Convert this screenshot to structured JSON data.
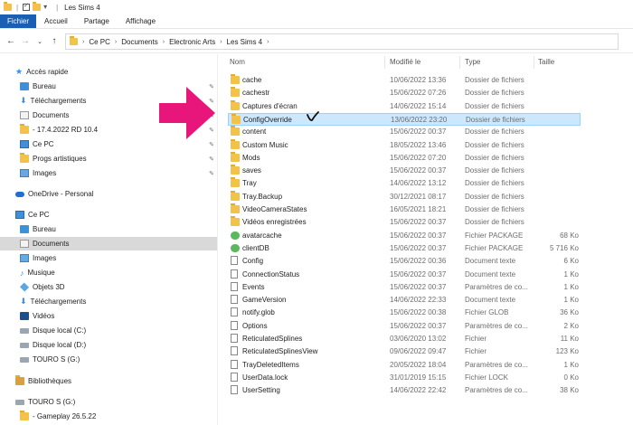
{
  "titlebar": {
    "title": "Les Sims 4",
    "quick_access_icons": [
      "properties-icon",
      "folder-icon",
      "customize-icon"
    ]
  },
  "ribbon": {
    "tabs": [
      "Fichier",
      "Accueil",
      "Partage",
      "Affichage"
    ]
  },
  "address": {
    "back_icon": "arrow-left-icon",
    "forward_icon": "arrow-right-icon",
    "recent_icon": "chevron-down-icon",
    "up_icon": "arrow-up-icon",
    "path": [
      "Ce PC",
      "Documents",
      "Electronic Arts",
      "Les Sims 4"
    ]
  },
  "sidebar": {
    "items": [
      {
        "label": "Accès rapide",
        "icon": "star-icon"
      },
      {
        "label": "Bureau",
        "icon": "desktop-icon",
        "pinned": true
      },
      {
        "label": "Téléchargements",
        "icon": "download-icon",
        "pinned": true
      },
      {
        "label": "Documents",
        "icon": "documents-icon",
        "pinned": true
      },
      {
        "label": "-    17.4.2022 RD 10.4",
        "icon": "folder-icon",
        "pinned": true
      },
      {
        "label": "Ce PC",
        "icon": "computer-icon",
        "pinned": true
      },
      {
        "label": "Progs  artistiques",
        "icon": "folder-icon",
        "pinned": true
      },
      {
        "label": "Images",
        "icon": "pictures-icon",
        "pinned": true
      },
      {
        "label": "OneDrive - Personal",
        "icon": "cloud-icon"
      },
      {
        "label": "Ce PC",
        "icon": "computer-icon"
      },
      {
        "label": "Bureau",
        "icon": "desktop-icon"
      },
      {
        "label": "Documents",
        "icon": "documents-icon",
        "selected": true
      },
      {
        "label": "Images",
        "icon": "pictures-icon"
      },
      {
        "label": "Musique",
        "icon": "music-icon"
      },
      {
        "label": "Objets 3D",
        "icon": "cube-icon"
      },
      {
        "label": "Téléchargements",
        "icon": "download-icon"
      },
      {
        "label": "Vidéos",
        "icon": "video-icon"
      },
      {
        "label": "Disque local (C:)",
        "icon": "drive-icon"
      },
      {
        "label": "Disque local (D:)",
        "icon": "drive-icon"
      },
      {
        "label": "TOURO S (G:)",
        "icon": "drive-icon"
      },
      {
        "label": "Bibliothèques",
        "icon": "library-icon"
      },
      {
        "label": "TOURO S (G:)",
        "icon": "drive-icon"
      },
      {
        "label": "-          Gameplay 26.5.22",
        "icon": "folder-icon"
      }
    ]
  },
  "columns": {
    "name": "Nom",
    "modified": "Modifié le",
    "type": "Type",
    "size": "Taille"
  },
  "files": [
    {
      "name": "cache",
      "date": "10/06/2022 13:36",
      "type": "Dossier de fichiers",
      "size": "",
      "kind": "folder"
    },
    {
      "name": "cachestr",
      "date": "15/06/2022 07:26",
      "type": "Dossier de fichiers",
      "size": "",
      "kind": "folder"
    },
    {
      "name": "Captures d'écran",
      "date": "14/06/2022 15:14",
      "type": "Dossier de fichiers",
      "size": "",
      "kind": "folder"
    },
    {
      "name": "ConfigOverride",
      "date": "13/06/2022 23:20",
      "type": "Dossier de fichiers",
      "size": "",
      "kind": "folder",
      "selected": true
    },
    {
      "name": "content",
      "date": "15/06/2022 00:37",
      "type": "Dossier de fichiers",
      "size": "",
      "kind": "folder"
    },
    {
      "name": "Custom Music",
      "date": "18/05/2022 13:46",
      "type": "Dossier de fichiers",
      "size": "",
      "kind": "folder"
    },
    {
      "name": "Mods",
      "date": "15/06/2022 07:20",
      "type": "Dossier de fichiers",
      "size": "",
      "kind": "folder"
    },
    {
      "name": "saves",
      "date": "15/06/2022 00:37",
      "type": "Dossier de fichiers",
      "size": "",
      "kind": "folder"
    },
    {
      "name": "Tray",
      "date": "14/06/2022 13:12",
      "type": "Dossier de fichiers",
      "size": "",
      "kind": "folder"
    },
    {
      "name": "Tray.Backup",
      "date": "30/12/2021 08:17",
      "type": "Dossier de fichiers",
      "size": "",
      "kind": "folder"
    },
    {
      "name": "VideoCameraStates",
      "date": "16/05/2021 18:21",
      "type": "Dossier de fichiers",
      "size": "",
      "kind": "folder"
    },
    {
      "name": "Vidéos enregistrées",
      "date": "15/06/2022 00:37",
      "type": "Dossier de fichiers",
      "size": "",
      "kind": "folder"
    },
    {
      "name": "avatarcache",
      "date": "15/06/2022 00:37",
      "type": "Fichier PACKAGE",
      "size": "68 Ko",
      "kind": "package"
    },
    {
      "name": "clientDB",
      "date": "15/06/2022 00:37",
      "type": "Fichier PACKAGE",
      "size": "5 716 Ko",
      "kind": "package"
    },
    {
      "name": "Config",
      "date": "15/06/2022 00:36",
      "type": "Document texte",
      "size": "6 Ko",
      "kind": "doc"
    },
    {
      "name": "ConnectionStatus",
      "date": "15/06/2022 00:37",
      "type": "Document texte",
      "size": "1 Ko",
      "kind": "doc"
    },
    {
      "name": "Events",
      "date": "15/06/2022 00:37",
      "type": "Paramètres de co...",
      "size": "1 Ko",
      "kind": "doc"
    },
    {
      "name": "GameVersion",
      "date": "14/06/2022 22:33",
      "type": "Document texte",
      "size": "1 Ko",
      "kind": "doc"
    },
    {
      "name": "notify.glob",
      "date": "15/06/2022 00:38",
      "type": "Fichier GLOB",
      "size": "36 Ko",
      "kind": "doc"
    },
    {
      "name": "Options",
      "date": "15/06/2022 00:37",
      "type": "Paramètres de co...",
      "size": "2 Ko",
      "kind": "doc"
    },
    {
      "name": "ReticulatedSplines",
      "date": "03/06/2020 13:02",
      "type": "Fichier",
      "size": "11 Ko",
      "kind": "doc"
    },
    {
      "name": "ReticulatedSplinesView",
      "date": "09/06/2022 09:47",
      "type": "Fichier",
      "size": "123 Ko",
      "kind": "doc"
    },
    {
      "name": "TrayDeletedItems",
      "date": "20/05/2022 18:04",
      "type": "Paramètres de co...",
      "size": "1 Ko",
      "kind": "doc"
    },
    {
      "name": "UserData.lock",
      "date": "31/01/2019 15:15",
      "type": "Fichier LOCK",
      "size": "0 Ko",
      "kind": "doc"
    },
    {
      "name": "UserSetting",
      "date": "14/06/2022 22:42",
      "type": "Paramètres de co...",
      "size": "38 Ko",
      "kind": "doc"
    }
  ],
  "annotations": {
    "arrow_color": "#e8157a",
    "arrow_icon": "pink-arrow-annotation",
    "checkmark_icon": "handwritten-check-annotation"
  },
  "colors": {
    "file_tab": "#1a5fb4",
    "selection": "#cce8ff",
    "folder": "#f3c24a"
  }
}
